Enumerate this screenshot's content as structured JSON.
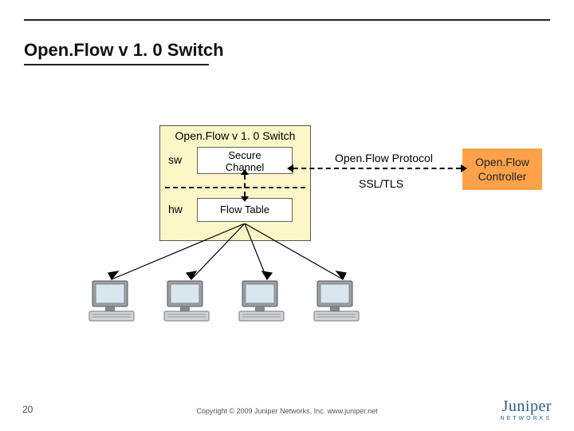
{
  "page_title": "Open.Flow v 1. 0 Switch",
  "switch": {
    "box_title": "Open.Flow v 1. 0 Switch",
    "sw_label": "sw",
    "secure_channel": "Secure\nChannel",
    "hw_label": "hw",
    "flow_table": "Flow Table"
  },
  "link": {
    "protocol": "Open.Flow Protocol",
    "transport": "SSL/TLS"
  },
  "controller": {
    "line1": "Open.Flow",
    "line2": "Controller"
  },
  "page_number": "20",
  "copyright": "Copyright © 2009 Juniper Networks, Inc.   www.juniper.net",
  "logo": {
    "brand": "Juniper",
    "sub": "NETWORKS"
  },
  "host_count": 4
}
